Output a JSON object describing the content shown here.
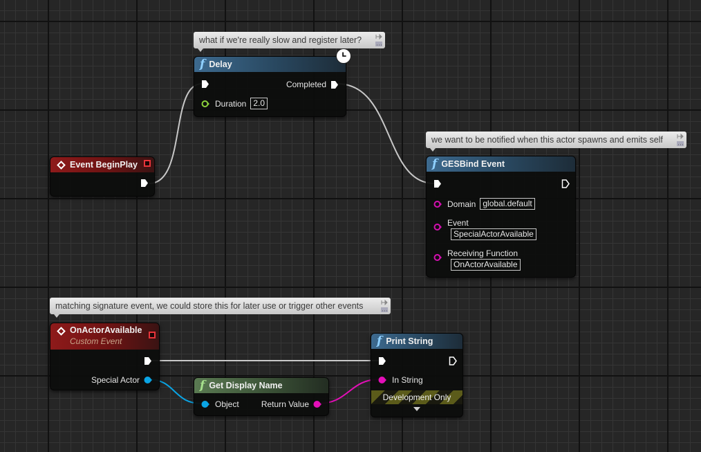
{
  "canvas": {
    "background": "#262626",
    "wire_colors": {
      "exec": "#c8c8c8",
      "object": "#0aa5e5",
      "string": "#e40fb8"
    }
  },
  "comments": [
    {
      "id": "delay-comment",
      "text": "what if we're really slow and register later?"
    },
    {
      "id": "bind-comment",
      "text": "we want to be notified when this actor spawns and emits self"
    },
    {
      "id": "custom-event-comment",
      "text": "matching signature event, we could store this for later use or trigger other events"
    }
  ],
  "nodes": {
    "begin_play": {
      "title": "Event BeginPlay",
      "type": "event",
      "color": "#8e1a1a"
    },
    "delay": {
      "title": "Delay",
      "type": "function",
      "latent_icon": "clock-icon",
      "outputs": {
        "completed": "Completed"
      },
      "inputs": {
        "duration_label": "Duration",
        "duration_value": "2.0"
      }
    },
    "ges_bind": {
      "title": "GESBind Event",
      "type": "function",
      "inputs": {
        "domain_label": "Domain",
        "domain_value": "global.default",
        "event_label": "Event",
        "event_value": "SpecialActorAvailable",
        "receiving_label": "Receiving Function",
        "receiving_value": "OnActorAvailable"
      }
    },
    "on_actor_available": {
      "title": "OnActorAvailable",
      "subtitle": "Custom Event",
      "type": "event",
      "outputs": {
        "special_actor": "Special Actor"
      }
    },
    "get_display_name": {
      "title": "Get Display Name",
      "type": "pure-function",
      "inputs": {
        "object": "Object"
      },
      "outputs": {
        "return_value": "Return Value"
      }
    },
    "print_string": {
      "title": "Print String",
      "type": "function",
      "inputs": {
        "in_string": "In String"
      },
      "banner": "Development Only",
      "expand_icon": "chevron-down-icon"
    }
  }
}
